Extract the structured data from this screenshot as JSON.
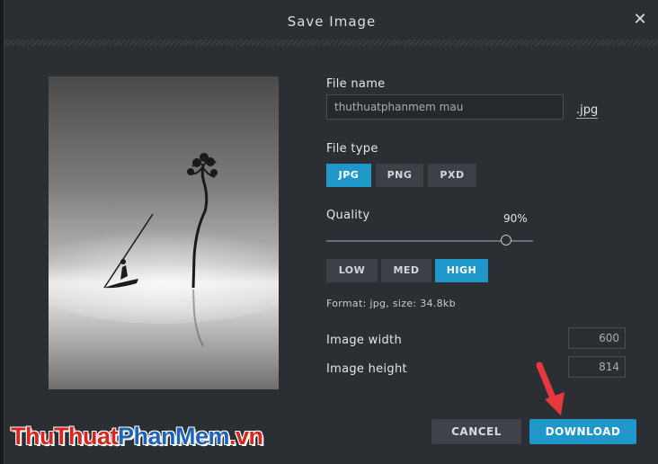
{
  "dialog": {
    "title": "Save Image",
    "close_icon": "close-icon"
  },
  "file_name": {
    "label": "File name",
    "value": "thuthuatphanmem mau",
    "extension": ".jpg"
  },
  "file_type": {
    "label": "File type",
    "options": [
      "JPG",
      "PNG",
      "PXD"
    ],
    "selected": "JPG"
  },
  "quality": {
    "label": "Quality",
    "value_text": "90%",
    "value": 0.9,
    "presets": [
      "LOW",
      "MED",
      "HIGH"
    ],
    "selected_preset": "HIGH"
  },
  "format_info": "Format: jpg, size: 34.8kb",
  "dimensions": {
    "width_label": "Image width",
    "width_value": "600",
    "height_label": "Image height",
    "height_value": "814"
  },
  "actions": {
    "cancel": "CANCEL",
    "download": "DOWNLOAD"
  },
  "colors": {
    "accent": "#1f97c9",
    "dialog_bg": "#2b2e33",
    "arrow": "#e8383d"
  },
  "watermark": {
    "part1": "ThuThuat",
    "part2": "PhanMem",
    "part3": ".vn"
  }
}
